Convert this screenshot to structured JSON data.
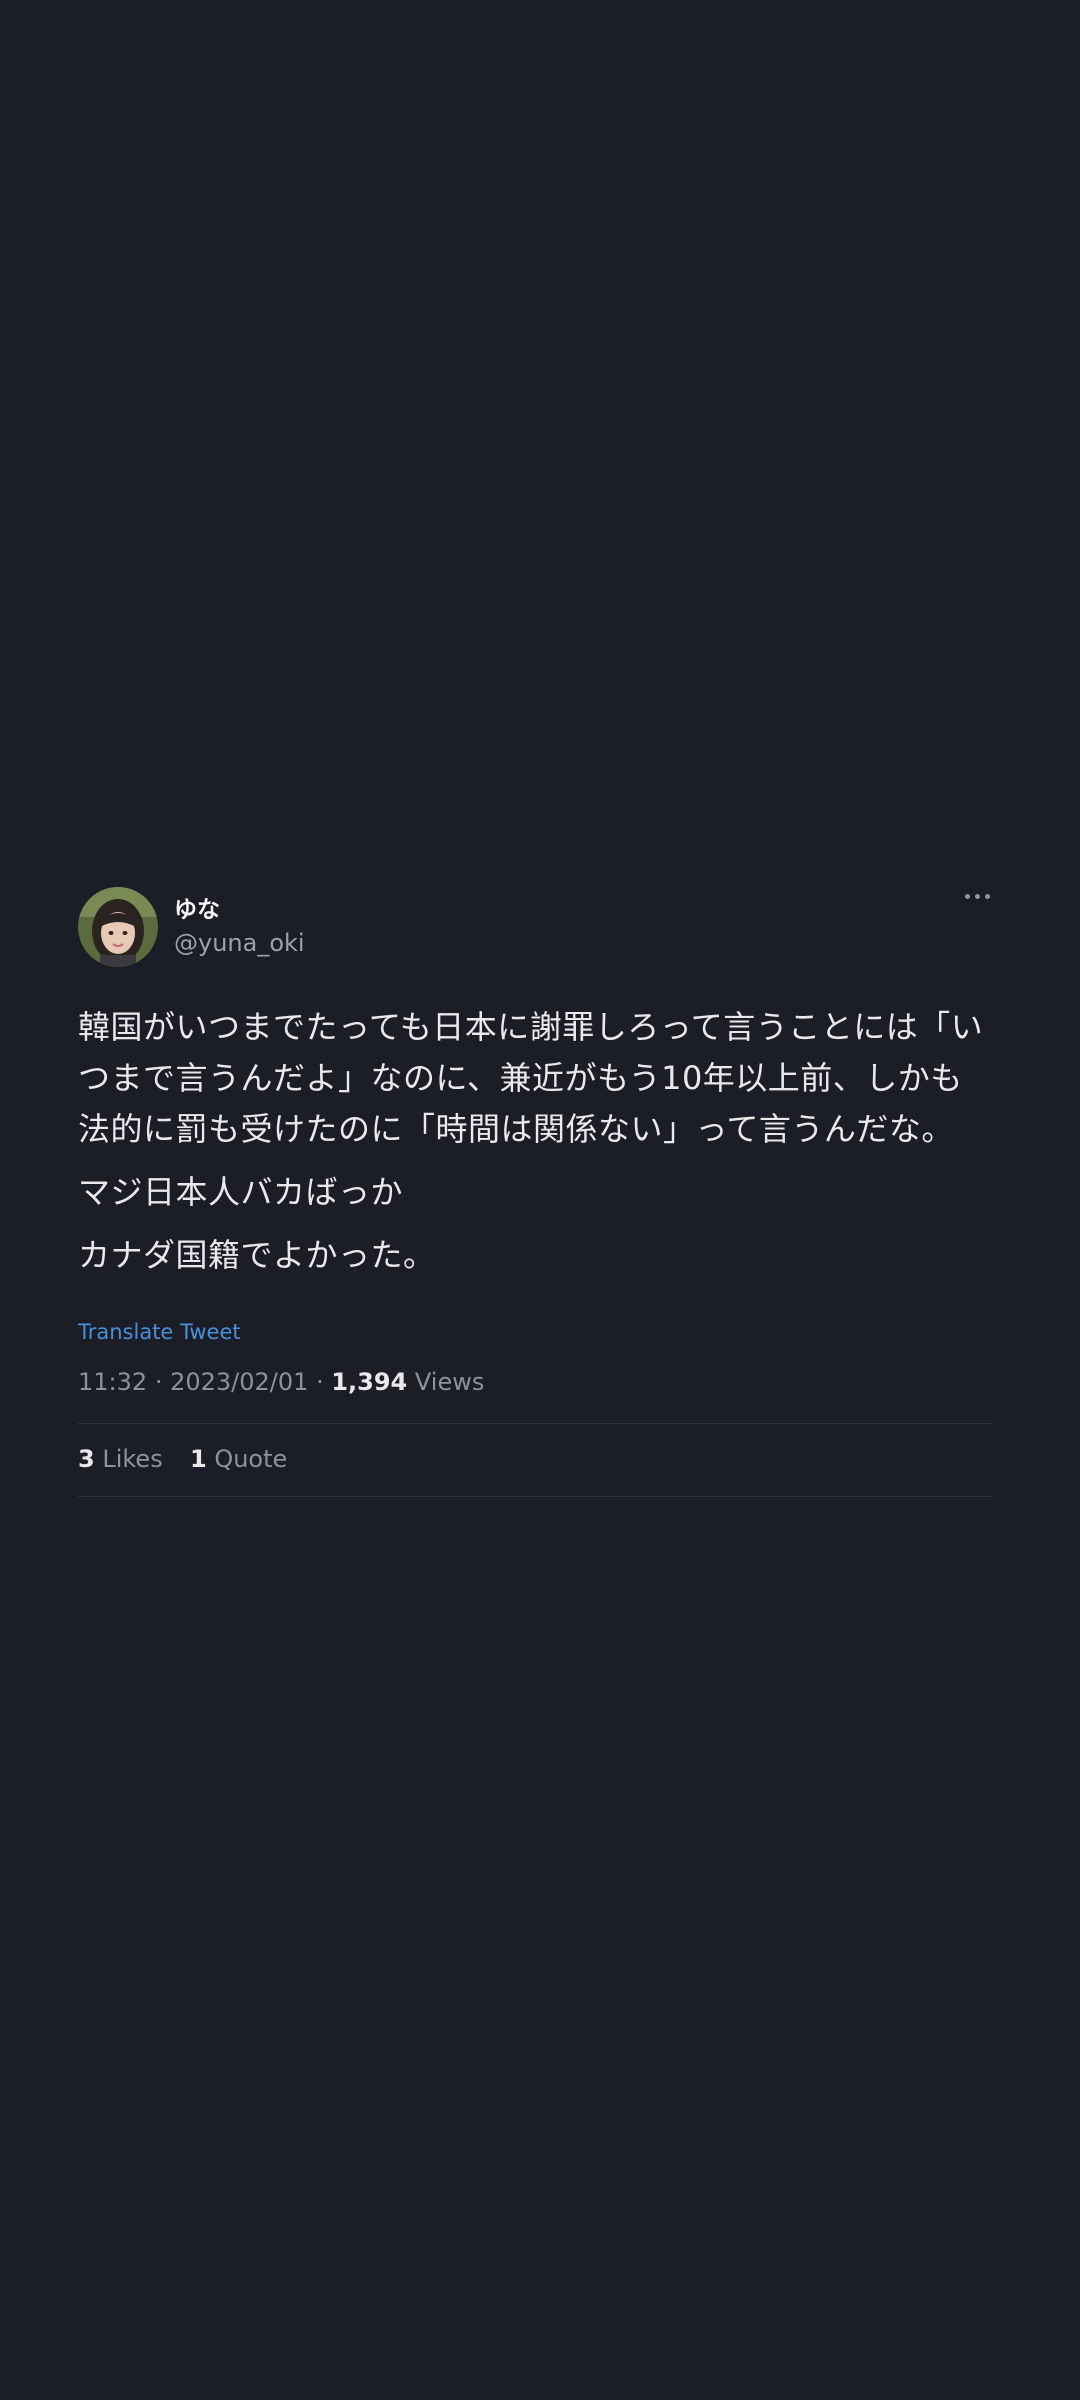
{
  "tweet": {
    "display_name": "ゆな",
    "handle": "@yuna_oki",
    "more_icon": "more-horizontal-icon",
    "paragraphs": [
      "韓国がいつまでたっても日本に謝罪しろって言うことには「いつまで言うんだよ」なのに、兼近がもう10年以上前、しかも法的に罰も受けたのに「時間は関係ない」って言うんだな。",
      "マジ日本人バカばっか",
      "カナダ国籍でよかった。"
    ],
    "translate_label": "Translate Tweet",
    "time": "11:32",
    "date": "2023/02/01",
    "views_count": "1,394",
    "views_label": "Views",
    "likes_count": "3",
    "likes_label": "Likes",
    "quote_count": "1",
    "quote_label": "Quote",
    "separator": "·"
  },
  "colors": {
    "background": "#1b1d27",
    "link": "#4a90d9",
    "muted": "#8b949e",
    "text": "#e7e9ea"
  }
}
